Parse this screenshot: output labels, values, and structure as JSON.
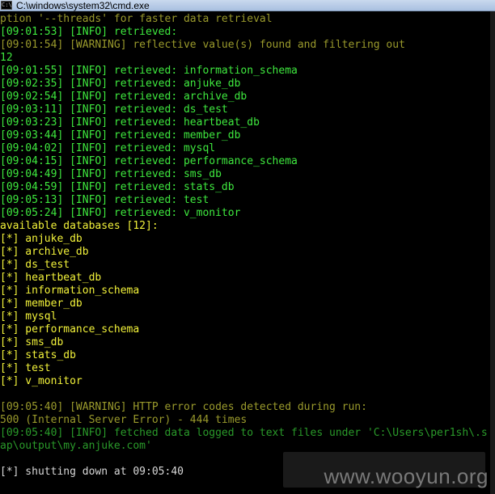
{
  "window": {
    "title": "C:\\windows\\system32\\cmd.exe",
    "icon_label": "C:\\"
  },
  "colors": {
    "green": "#3ee83e",
    "yellow": "#f2f23a",
    "dim_yellow": "#9a9a2c",
    "dim_green": "#2a9a2a",
    "white": "#d8d8d8"
  },
  "console_lines": [
    {
      "text": "ption '--threads' for faster data retrieval",
      "color": "dim_yellow"
    },
    {
      "text": "[09:01:53] [INFO] retrieved:",
      "color": "green"
    },
    {
      "text": "[09:01:54] [WARNING] reflective value(s) found and filtering out",
      "color": "dim_yellow"
    },
    {
      "text": "12",
      "color": "green"
    },
    {
      "text": "[09:01:55] [INFO] retrieved: information_schema",
      "color": "green"
    },
    {
      "text": "[09:02:35] [INFO] retrieved: anjuke_db",
      "color": "green"
    },
    {
      "text": "[09:02:54] [INFO] retrieved: archive_db",
      "color": "green"
    },
    {
      "text": "[09:03:11] [INFO] retrieved: ds_test",
      "color": "green"
    },
    {
      "text": "[09:03:23] [INFO] retrieved: heartbeat_db",
      "color": "green"
    },
    {
      "text": "[09:03:44] [INFO] retrieved: member_db",
      "color": "green"
    },
    {
      "text": "[09:04:02] [INFO] retrieved: mysql",
      "color": "green"
    },
    {
      "text": "[09:04:15] [INFO] retrieved: performance_schema",
      "color": "green"
    },
    {
      "text": "[09:04:49] [INFO] retrieved: sms_db",
      "color": "green"
    },
    {
      "text": "[09:04:59] [INFO] retrieved: stats_db",
      "color": "green"
    },
    {
      "text": "[09:05:13] [INFO] retrieved: test",
      "color": "green"
    },
    {
      "text": "[09:05:24] [INFO] retrieved: v_monitor",
      "color": "green"
    },
    {
      "text": "available databases [12]:",
      "color": "yellow"
    },
    {
      "text": "[*] anjuke_db",
      "color": "yellow"
    },
    {
      "text": "[*] archive_db",
      "color": "yellow"
    },
    {
      "text": "[*] ds_test",
      "color": "yellow"
    },
    {
      "text": "[*] heartbeat_db",
      "color": "yellow"
    },
    {
      "text": "[*] information_schema",
      "color": "yellow"
    },
    {
      "text": "[*] member_db",
      "color": "yellow"
    },
    {
      "text": "[*] mysql",
      "color": "yellow"
    },
    {
      "text": "[*] performance_schema",
      "color": "yellow"
    },
    {
      "text": "[*] sms_db",
      "color": "yellow"
    },
    {
      "text": "[*] stats_db",
      "color": "yellow"
    },
    {
      "text": "[*] test",
      "color": "yellow"
    },
    {
      "text": "[*] v_monitor",
      "color": "yellow"
    },
    {
      "text": "",
      "color": "white"
    },
    {
      "text": "[09:05:40] [WARNING] HTTP error codes detected during run:",
      "color": "dim_yellow"
    },
    {
      "text": "500 (Internal Server Error) - 444 times",
      "color": "dim_yellow"
    },
    {
      "text": "[09:05:40] [INFO] fetched data logged to text files under 'C:\\Users\\per1sh\\.s",
      "color": "dim_green"
    },
    {
      "text": "ap\\output\\my.anjuke.com'",
      "color": "dim_green"
    },
    {
      "text": "",
      "color": "white"
    },
    {
      "text": "[*] shutting down at 09:05:40",
      "color": "white"
    }
  ],
  "watermark": {
    "text": "www.wooyun.org"
  }
}
